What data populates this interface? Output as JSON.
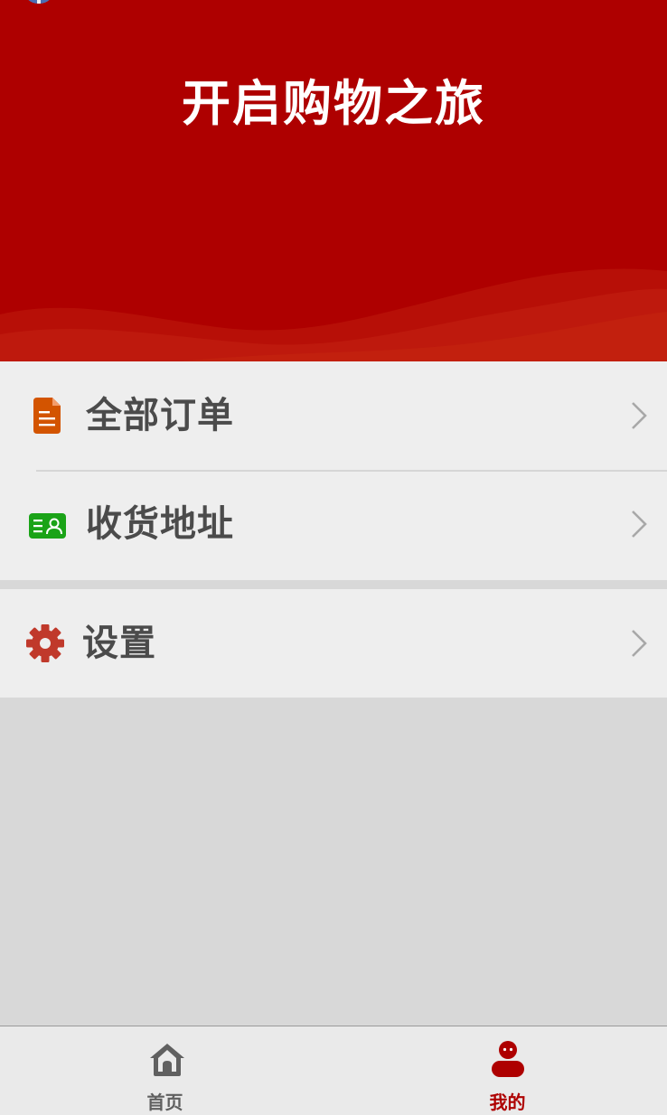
{
  "banner": {
    "title": "开启购物之旅",
    "background_color": "#ae0000"
  },
  "menu": {
    "items": [
      {
        "label": "全部订单",
        "icon": "order-document-icon",
        "icon_color": "#d35400"
      },
      {
        "label": "收货地址",
        "icon": "address-card-icon",
        "icon_color": "#1aa317"
      },
      {
        "label": "设置",
        "icon": "gear-icon",
        "icon_color": "#c0392b"
      }
    ],
    "chevron_icon": "chevron-right-icon"
  },
  "tabbar": {
    "tabs": [
      {
        "label": "首页",
        "icon": "home-icon",
        "active": false
      },
      {
        "label": "我的",
        "icon": "user-icon",
        "active": true
      }
    ],
    "active_color": "#ae0000",
    "inactive_color": "#606060"
  }
}
